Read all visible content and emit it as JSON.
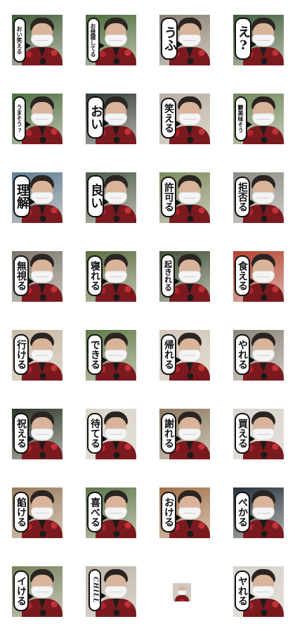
{
  "stickers": [
    {
      "label": "おい笑える",
      "bg": "#3f5a37"
    },
    {
      "label": "お昼寝してる",
      "bg": "#4a6b3a"
    },
    {
      "label": "うふ",
      "bg": "#8a7f73"
    },
    {
      "label": "え?",
      "bg": "#3e5c3a"
    },
    {
      "label": "うまそう?",
      "bg": "#4d6e3f"
    },
    {
      "label": "おい",
      "bg": "#2f3a32"
    },
    {
      "label": "笑える",
      "bg": "#b8b0a4"
    },
    {
      "label": "鬱美味そう",
      "bg": "#6f8a5a"
    },
    {
      "label": "理解",
      "bg": "#5f7d92"
    },
    {
      "label": "良い",
      "bg": "#4c5a48"
    },
    {
      "label": "許可る",
      "bg": "#7c8b5e"
    },
    {
      "label": "拒否る",
      "bg": "#8d8a86"
    },
    {
      "label": "無視る",
      "bg": "#7a746a"
    },
    {
      "label": "寝れる",
      "bg": "#5a6d3f"
    },
    {
      "label": "起きれる",
      "bg": "#405237"
    },
    {
      "label": "食える",
      "bg": "#b5402c"
    },
    {
      "label": "行ける",
      "bg": "#c9b9a3"
    },
    {
      "label": "できる",
      "bg": "#5f7a47"
    },
    {
      "label": "帰れる",
      "bg": "#d3c8b9"
    },
    {
      "label": "やれる",
      "bg": "#8b8479"
    },
    {
      "label": "祝える",
      "bg": "#2b3527"
    },
    {
      "label": "待てる",
      "bg": "#dcd6cc"
    },
    {
      "label": "謝れる",
      "bg": "#8d7a5f"
    },
    {
      "label": "買える",
      "bg": "#d9d5cf"
    },
    {
      "label": "餡ける",
      "bg": "#9a7b5b"
    },
    {
      "label": "喜べる",
      "bg": "#5e7748"
    },
    {
      "label": "おける",
      "bg": "#a47048"
    },
    {
      "label": "ぺかる",
      "bg": "#27313d"
    },
    {
      "label": "イける",
      "bg": "#74805a"
    },
    {
      "label": "CHILL",
      "bg": "#bdb5aa"
    },
    {
      "label": "ヤれる",
      "bg": "#d7d2cb"
    }
  ]
}
